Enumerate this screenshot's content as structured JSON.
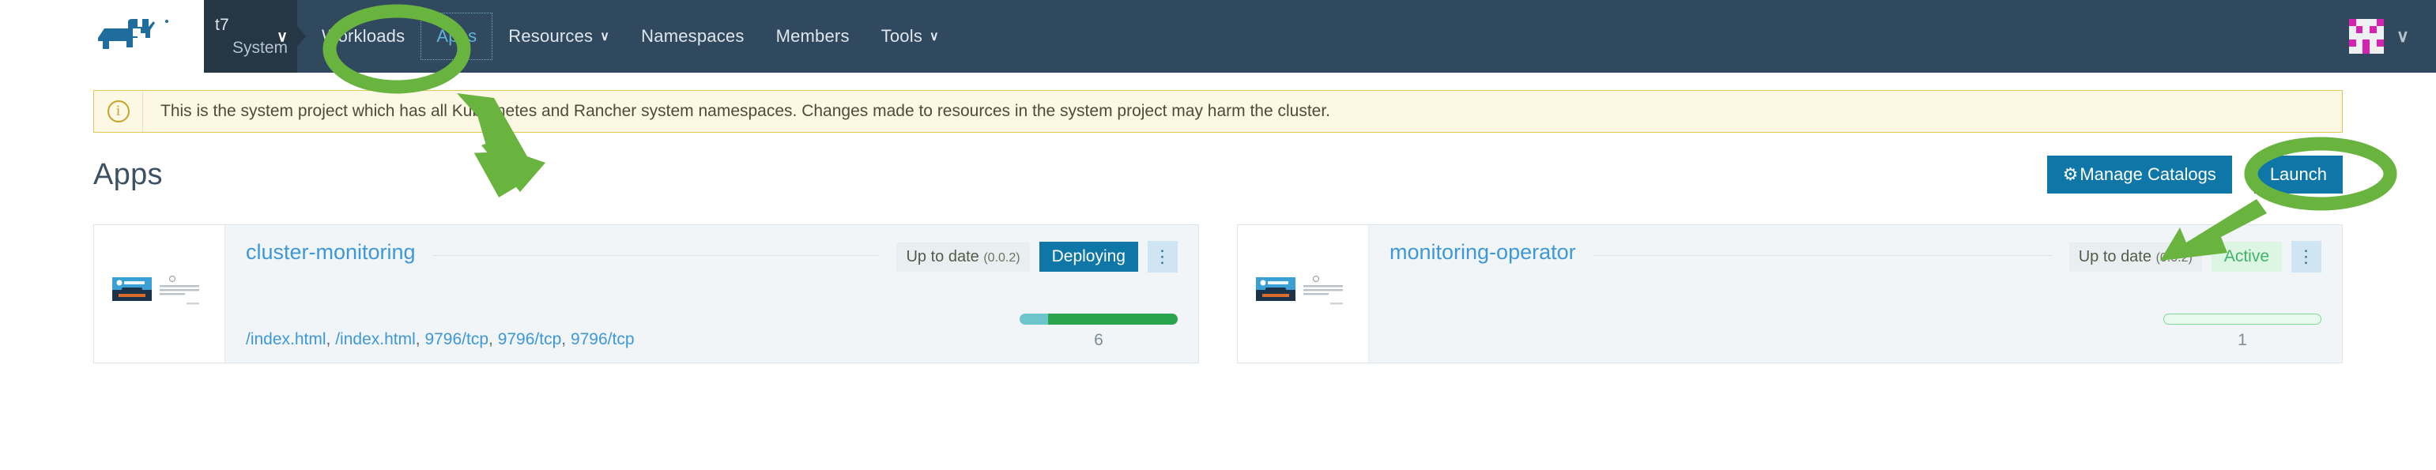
{
  "header": {
    "logo_name": "rancher-cow-logo",
    "project_selector": {
      "cluster": "t7",
      "project": "System",
      "chevron": "∨"
    },
    "nav_items": [
      {
        "label": "Workloads",
        "active": false,
        "has_chevron": false
      },
      {
        "label": "Apps",
        "active": true,
        "has_chevron": false
      },
      {
        "label": "Resources",
        "active": false,
        "has_chevron": true
      },
      {
        "label": "Namespaces",
        "active": false,
        "has_chevron": false
      },
      {
        "label": "Members",
        "active": false,
        "has_chevron": false
      },
      {
        "label": "Tools",
        "active": false,
        "has_chevron": true
      }
    ],
    "chevron_glyph": "∨",
    "avatar_chevron": "∨",
    "bg_color": "#31495e",
    "selector_bg_color": "#253745",
    "active_nav_color": "#5fb4d8"
  },
  "banner": {
    "icon": "info-circle-icon",
    "icon_glyph": "i",
    "text": "This is the system project which has all Kubernetes and Rancher system namespaces. Changes made to resources in the system project may harm the cluster.",
    "bg_color": "#fcf8e3",
    "border_color": "#e0c653"
  },
  "page": {
    "title": "Apps",
    "manage_catalogs_label": "Manage Catalogs",
    "manage_catalogs_icon": "gear-icon",
    "gear_glyph": "⚙",
    "launch_label": "Launch",
    "button_color": "#0f76a8"
  },
  "apps": [
    {
      "name": "cluster-monitoring",
      "thumbnail": "prometheus-operator-thumbnail",
      "up_to_date_label": "Up to date",
      "version": "(0.0.2)",
      "status": "Deploying",
      "status_style": "deploying",
      "kebab": "kebab-menu-icon",
      "links": [
        "/index.html",
        "/index.html",
        "9796/tcp",
        "9796/tcp",
        "9796/tcp"
      ],
      "progress": {
        "style": "filled",
        "segments": [
          18,
          82
        ],
        "count": "6"
      }
    },
    {
      "name": "monitoring-operator",
      "thumbnail": "prometheus-operator-thumbnail",
      "up_to_date_label": "Up to date",
      "version": "(0.0.2)",
      "status": "Active",
      "status_style": "active",
      "kebab": "kebab-menu-icon",
      "links": [],
      "progress": {
        "style": "outlined",
        "segments": [
          100
        ],
        "count": "1"
      }
    }
  ],
  "annotations": {
    "color": "#69b33f",
    "items": [
      {
        "type": "ellipse",
        "name": "highlight-circle-apps-tab"
      },
      {
        "type": "arrow",
        "name": "pointer-arrow-apps-tab"
      },
      {
        "type": "ellipse",
        "name": "highlight-circle-launch-button"
      },
      {
        "type": "arrow",
        "name": "pointer-arrow-launch-button"
      }
    ]
  }
}
